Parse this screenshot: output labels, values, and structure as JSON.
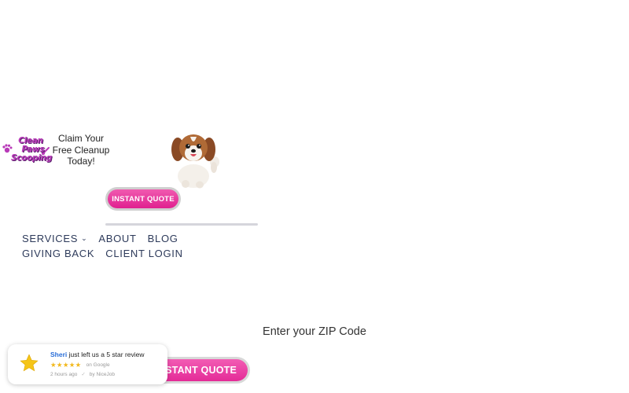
{
  "logo": {
    "lines": [
      "Clean",
      "Paws",
      "Scooping"
    ]
  },
  "promo": {
    "lines": [
      "Claim Your",
      "Free Cleanup",
      "Today!"
    ]
  },
  "top_button": {
    "label": "INSTANT QUOTE"
  },
  "nav": {
    "row1": [
      {
        "label": "SERVICES",
        "has_dropdown": true
      },
      {
        "label": "ABOUT"
      },
      {
        "label": "BLOG"
      }
    ],
    "row2": [
      {
        "label": "GIVING BACK"
      },
      {
        "label": "CLIENT LOGIN"
      }
    ]
  },
  "zip": {
    "label": "Enter your ZIP Code"
  },
  "bottom_button": {
    "label": "INSTANT QUOTE"
  },
  "review": {
    "name": "Sheri",
    "message": " just left us a 5 star review",
    "rating": 5,
    "source": "on Google",
    "time": "2 hours ago",
    "provider": "by NiceJob"
  },
  "colors": {
    "brand_pink": "#e0208f",
    "nav_text": "#2d3a5a",
    "star": "#f2b81c",
    "reviewer_name": "#2a6ed8"
  },
  "icons": [
    "paw-icon",
    "dog-illustration",
    "chevron-down-icon",
    "star-icon",
    "check-icon"
  ]
}
